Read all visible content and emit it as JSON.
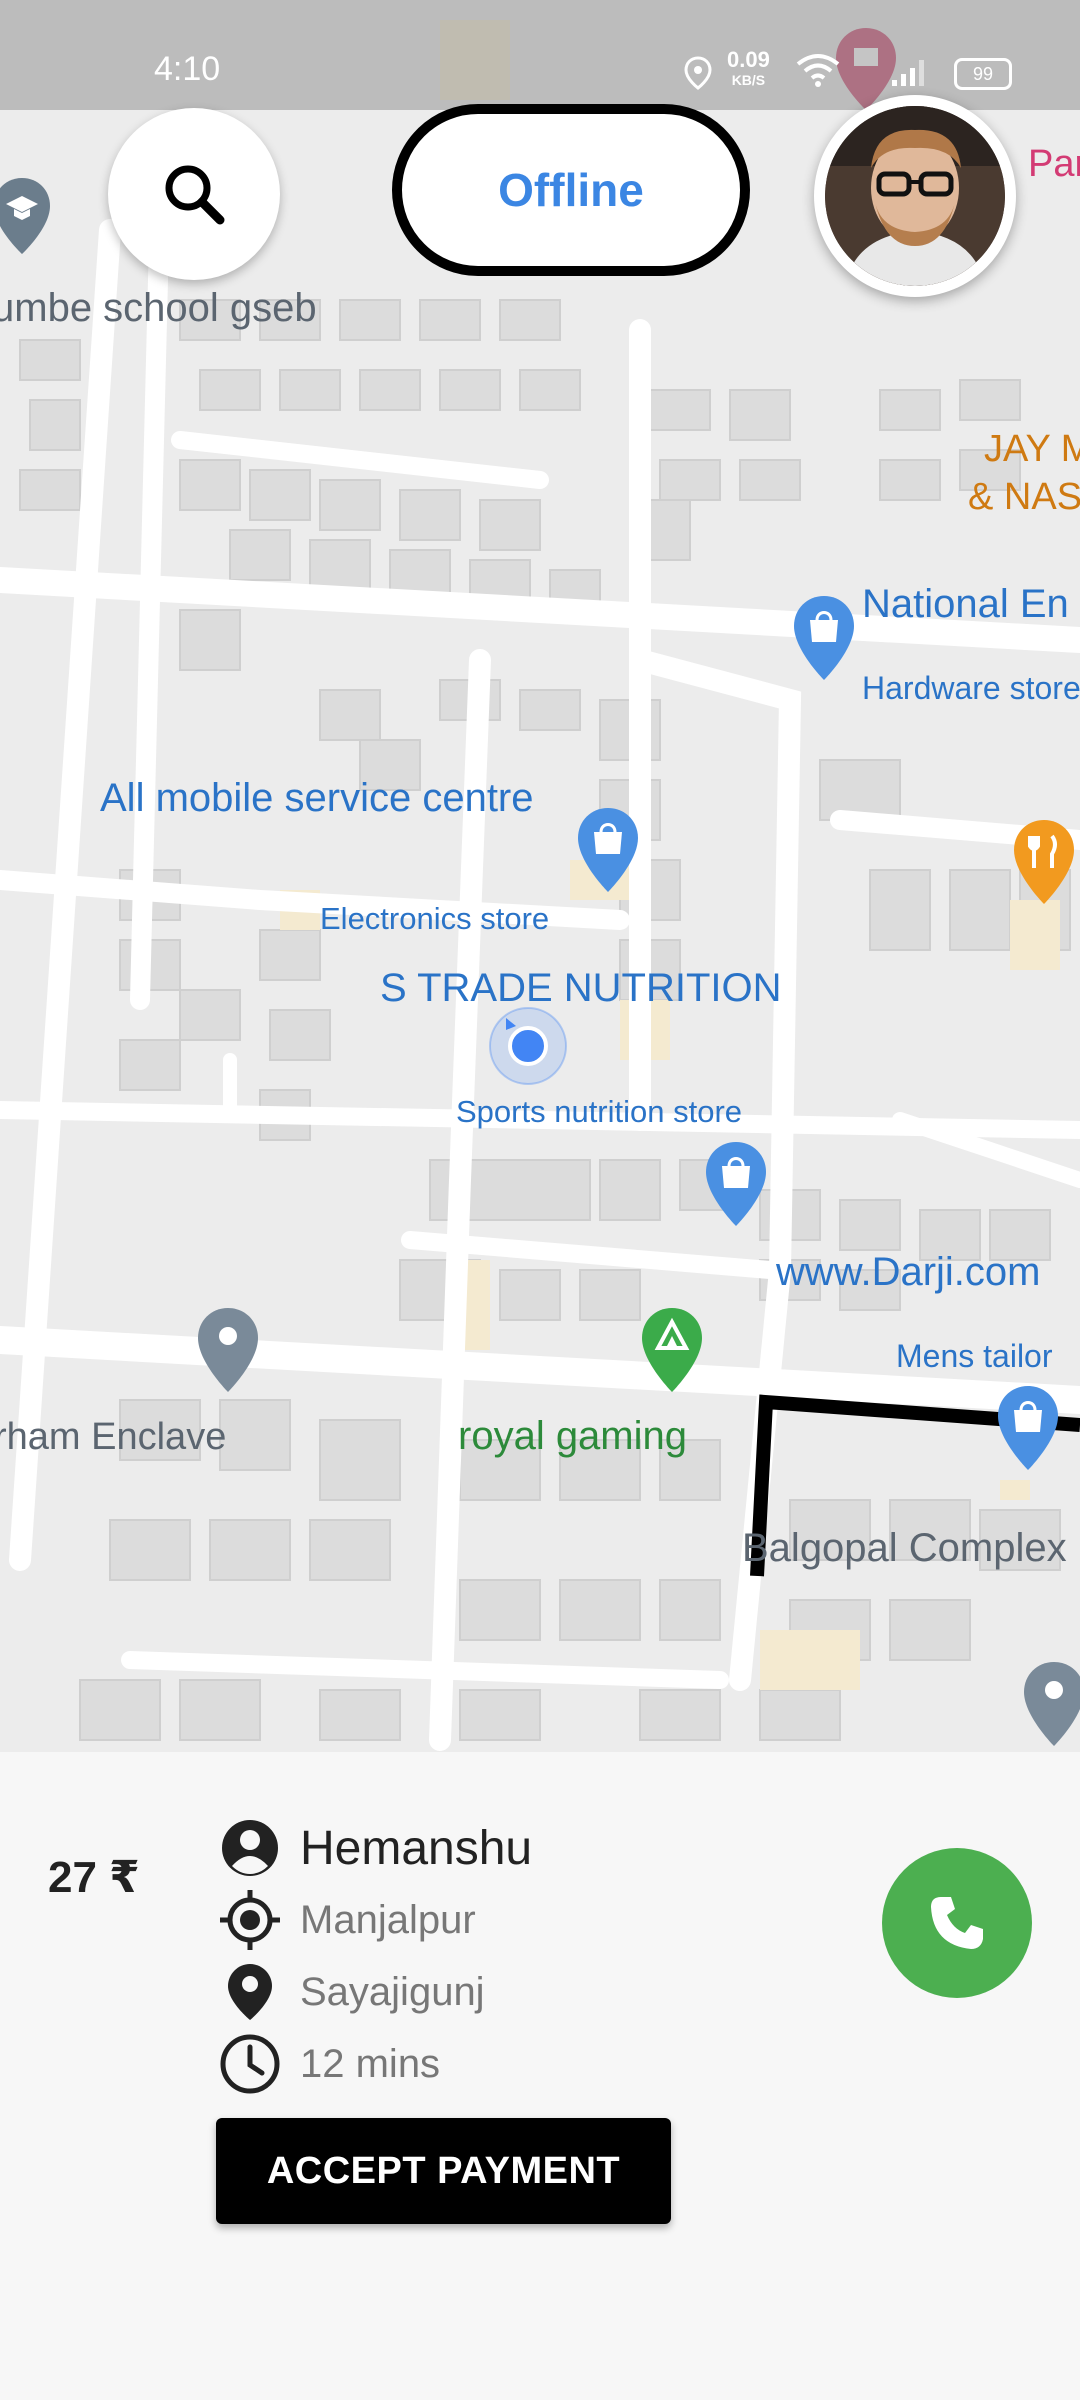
{
  "status_bar": {
    "time": "4:10",
    "net_speed": "0.09",
    "net_unit": "KB/S",
    "battery": "99"
  },
  "top_bar": {
    "status_label": "Offline",
    "search_icon": "search-icon",
    "avatar_icon": "avatar"
  },
  "map": {
    "labels": {
      "school": "umbe school gseb",
      "par": "Par",
      "jay_line1": "JAY M",
      "jay_line2": "& NAS",
      "national": "National En",
      "hardware": "Hardware store",
      "all_mobile": "All mobile service centre",
      "electronics": "Electronics store",
      "s_trade": "S TRADE NUTRITION",
      "sports": "Sports nutrition store",
      "darji": "www.Darji.com",
      "mens_tailor": "Mens tailor",
      "arham": "rham Enclave",
      "royal": "royal gaming",
      "balgopal": "Balgopal Complex"
    },
    "colors": {
      "poi_blue": "#2a73c7",
      "poi_orange": "#cf7a12",
      "poi_green": "#2c8a3a",
      "road": "#ffffff",
      "block": "#dadada"
    }
  },
  "ride": {
    "fare": "27 ₹",
    "passenger": "Hemanshu",
    "pickup": "Manjalpur",
    "drop": "Sayajigunj",
    "duration": "12 mins",
    "accept_label": "ACCEPT PAYMENT",
    "call_icon": "phone-icon",
    "call_color": "#4caf50"
  }
}
